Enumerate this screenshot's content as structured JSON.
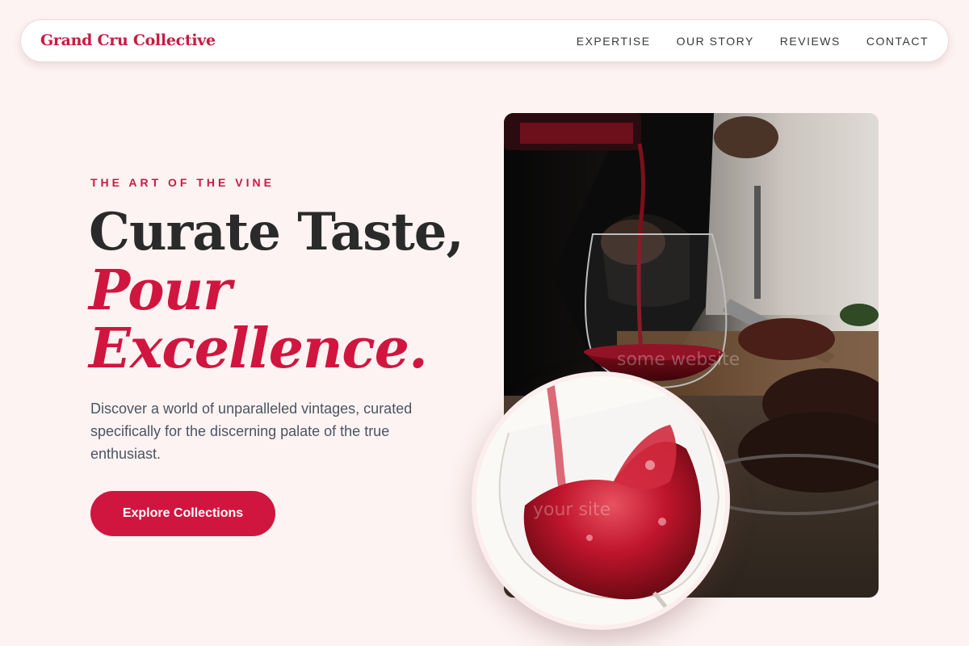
{
  "brand": {
    "name": "Grand Cru Collective"
  },
  "nav": {
    "links": [
      {
        "label": "EXPERTISE"
      },
      {
        "label": "OUR STORY"
      },
      {
        "label": "REVIEWS"
      },
      {
        "label": "CONTACT"
      }
    ]
  },
  "hero": {
    "eyebrow": "THE ART OF THE VINE",
    "headline_line1": "Curate Taste,",
    "headline_line2": "Pour",
    "headline_line3": "Excellence.",
    "description": "Discover a world of unparalleled vintages, curated specifically for the discerning palate of the true enthusiast.",
    "cta_label": "Explore Collections"
  },
  "images": {
    "main_watermark": "some website",
    "round_watermark": "your site"
  },
  "colors": {
    "accent": "#d0163f",
    "brand": "#c61c42",
    "background": "#fdf3f2",
    "heading": "#2a2a2a",
    "body_text": "#4b5563"
  }
}
